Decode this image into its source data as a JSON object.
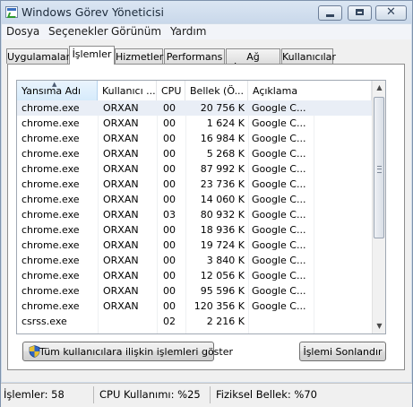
{
  "window": {
    "title": "Windows Görev Yöneticisi",
    "close_glyph": "✕"
  },
  "menu": [
    "Dosya",
    "Seçenekler",
    "Görünüm",
    "Yardım"
  ],
  "tabs": [
    "Uygulamalar",
    "İşlemler",
    "Hizmetler",
    "Performans",
    "Ağ İletişimi",
    "Kullanıcılar"
  ],
  "active_tab": "İşlemler",
  "table": {
    "columns": [
      "Yansıma Adı",
      "Kullanıcı ...",
      "CPU",
      "Bellek (Ö...",
      "Açıklama"
    ],
    "sorted_column": "Yansıma Adı",
    "rows": [
      [
        "chrome.exe",
        "ORXAN",
        "00",
        "20 756 K",
        "Google C..."
      ],
      [
        "chrome.exe",
        "ORXAN",
        "00",
        "1 624 K",
        "Google C..."
      ],
      [
        "chrome.exe",
        "ORXAN",
        "00",
        "16 984 K",
        "Google C..."
      ],
      [
        "chrome.exe",
        "ORXAN",
        "00",
        "5 268 K",
        "Google C..."
      ],
      [
        "chrome.exe",
        "ORXAN",
        "00",
        "87 992 K",
        "Google C..."
      ],
      [
        "chrome.exe",
        "ORXAN",
        "00",
        "23 736 K",
        "Google C..."
      ],
      [
        "chrome.exe",
        "ORXAN",
        "00",
        "14 060 K",
        "Google C..."
      ],
      [
        "chrome.exe",
        "ORXAN",
        "03",
        "80 932 K",
        "Google C..."
      ],
      [
        "chrome.exe",
        "ORXAN",
        "00",
        "18 936 K",
        "Google C..."
      ],
      [
        "chrome.exe",
        "ORXAN",
        "00",
        "19 724 K",
        "Google C..."
      ],
      [
        "chrome.exe",
        "ORXAN",
        "00",
        "3 840 K",
        "Google C..."
      ],
      [
        "chrome.exe",
        "ORXAN",
        "00",
        "12 056 K",
        "Google C..."
      ],
      [
        "chrome.exe",
        "ORXAN",
        "00",
        "95 596 K",
        "Google C..."
      ],
      [
        "chrome.exe",
        "ORXAN",
        "00",
        "120 356 K",
        "Google C..."
      ],
      [
        "csrss.exe",
        "",
        "02",
        "2 216 K",
        ""
      ]
    ],
    "selected_row": 0
  },
  "buttons": {
    "show_all": "Tüm kullanıcılara ilişkin işlemleri göster",
    "end_process": "İşlemi Sonlandır"
  },
  "status": {
    "processes": "İşlemler: 58",
    "cpu": "CPU Kullanımı: %25",
    "memory": "Fiziksel Bellek: %70"
  },
  "colors": {
    "window_frame": "#cfdbe9",
    "selected_row": "#e9eef6",
    "sorted_header": "#d6ebfb"
  },
  "icons": {
    "app": "task-manager-icon",
    "shield": "uac-shield-icon",
    "scroll_up": "▲",
    "scroll_down": "▼",
    "sort": "▲"
  }
}
